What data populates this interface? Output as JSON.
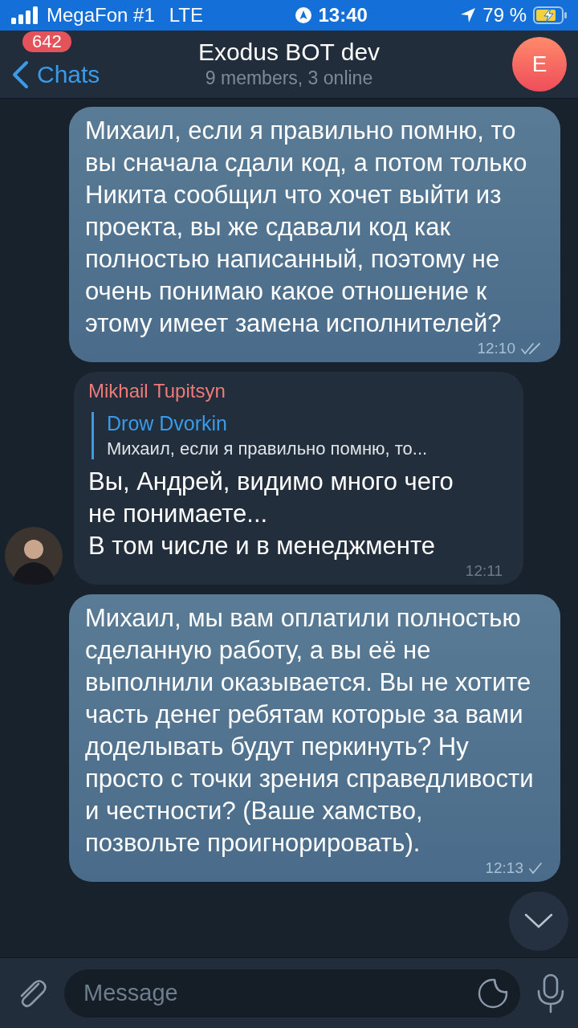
{
  "status_bar": {
    "carrier": "MegaFon #1",
    "network": "LTE",
    "time": "13:40",
    "battery": "79 %",
    "charging": true
  },
  "header": {
    "back_label": "Chats",
    "unread_badge": "642",
    "title": "Exodus BOT dev",
    "subtitle": "9 members, 3 online",
    "avatar_letter": "E"
  },
  "messages": [
    {
      "kind": "outgoing",
      "text": "Михаил, если я правильно помню, то вы сначала сдали код, а потом только Никита сообщил что хочет выйти из проекта, вы же сдавали код как полностью написанный, поэтому не очень понимаю какое отношение к этому имеет замена исполнителей?",
      "time": "12:10",
      "read": true
    },
    {
      "kind": "incoming",
      "sender": "Mikhail Tupitsyn",
      "reply": {
        "author": "Drow Dvorkin",
        "text": "Михаил, если я правильно помню, то..."
      },
      "text": "Вы, Андрей, видимо много чего\nне понимаете...\nВ том числе и в менеджменте",
      "time": "12:11"
    },
    {
      "kind": "outgoing",
      "text": "Михаил, мы вам оплатили полностью сделанную работу, а вы её не выполнили оказывается. Вы не хотите часть денег ребятам которые за вами доделывать будут перкинуть? Ну просто с точки зрения справедливости и честности? (Ваше хамство, позвольте проигнорировать).",
      "time": "12:13",
      "read": false
    }
  ],
  "composer": {
    "placeholder": "Message"
  }
}
